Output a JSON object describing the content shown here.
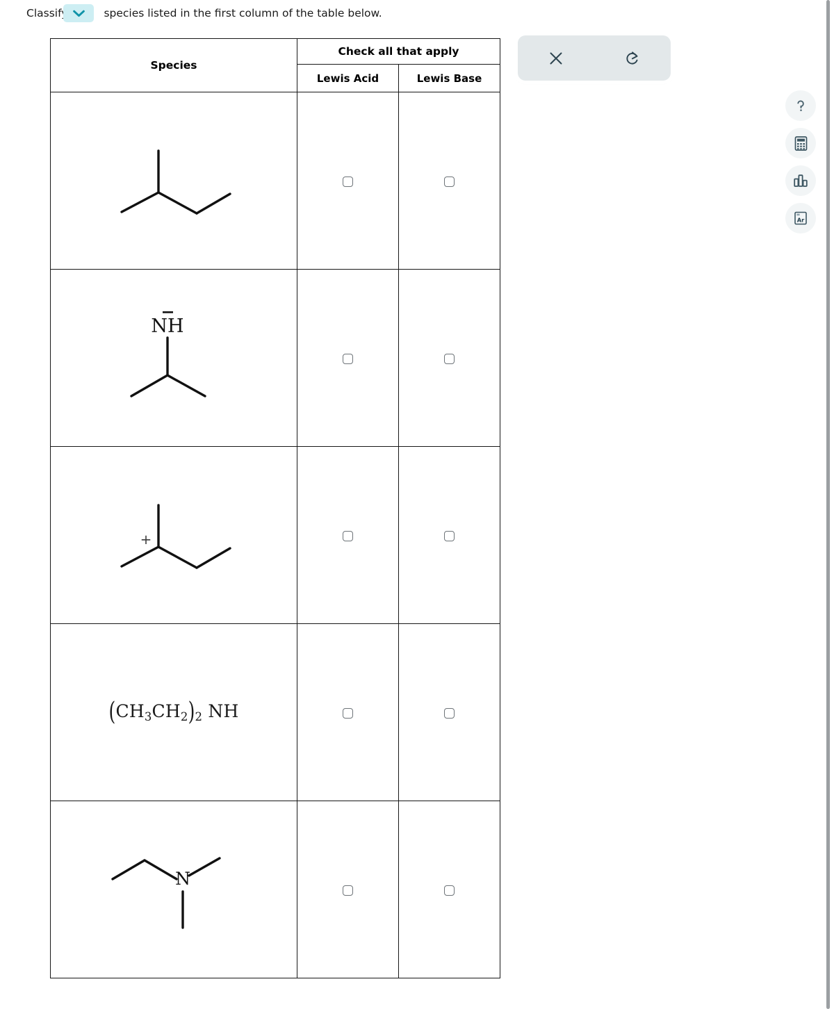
{
  "prompt": {
    "text_before": "Classify",
    "dropdown_icon": "chevron-down-icon",
    "dropdown_accent": "#cdeef3",
    "dropdown_chevron_color": "#0f93a8",
    "text_after": "species listed in the first column of the table below."
  },
  "table": {
    "col_species_header": "Species",
    "group_header": "Check all that apply",
    "col_lewis_acid": "Lewis Acid",
    "col_lewis_base": "Lewis Base",
    "rows": [
      {
        "species_name": "2-methylbutane",
        "render": "skeletal",
        "charge": "",
        "lewis_acid_checked": false,
        "lewis_base_checked": false
      },
      {
        "species_name": "isopropylamide anion",
        "render": "skeletal",
        "label": "NH",
        "charge": "−",
        "lewis_acid_checked": false,
        "lewis_base_checked": false
      },
      {
        "species_name": "2-methylbutyl cation",
        "render": "skeletal",
        "charge": "+",
        "lewis_acid_checked": false,
        "lewis_base_checked": false
      },
      {
        "species_name": "diethylamine",
        "render": "formula",
        "formula_parts": [
          "(",
          "CH",
          "3",
          "CH",
          "2",
          ")",
          "2",
          " NH"
        ],
        "formula_plain": "(CH3CH2)2 NH",
        "lewis_acid_checked": false,
        "lewis_base_checked": false
      },
      {
        "species_name": "N,N-dimethylethylamine",
        "render": "skeletal",
        "label": "N",
        "charge": "",
        "lewis_acid_checked": false,
        "lewis_base_checked": false
      }
    ]
  },
  "toolbar": {
    "clear_label": "clear",
    "clear_icon": "close-x-icon",
    "reset_label": "reset",
    "reset_icon": "undo-refresh-icon",
    "panel_color": "#e3e8ea"
  },
  "right_rail": {
    "items": [
      {
        "icon": "question-mark-icon",
        "label": "help"
      },
      {
        "icon": "calculator-icon",
        "label": "calculator"
      },
      {
        "icon": "bar-chart-icon",
        "label": "chart"
      },
      {
        "icon": "periodic-table-icon",
        "label": "Ar"
      }
    ],
    "periodic_symbol": "Ar"
  },
  "colors": {
    "ink": "#1a1a1a",
    "table_border": "#171717",
    "checkbox_border": "#6d7378",
    "rail_bg": "#f2f5f6",
    "icon_ink": "#2d4450"
  }
}
